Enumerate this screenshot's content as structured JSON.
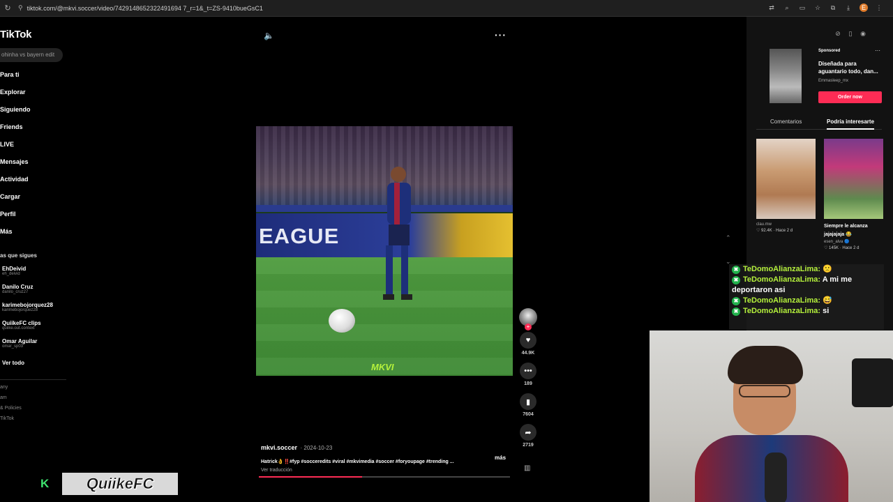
{
  "browser": {
    "url": "tiktok.com/@mkvi.soccer/video/7429148652322491694 7_r=1&_t=ZS-9410bueGsC1"
  },
  "sidebar": {
    "logo": "TikTok",
    "search_placeholder": "ohinha vs bayern edit",
    "nav": [
      "Para ti",
      "Explorar",
      "Siguiendo",
      "Friends",
      "LIVE",
      "Mensajes",
      "Actividad",
      "Cargar",
      "Perfil",
      "Más"
    ],
    "following_title": "as que sigues",
    "following": [
      {
        "name": "EhDeivid",
        "handle": "eh_deivid"
      },
      {
        "name": "Danilo Cruz",
        "handle": "danilo_cruz27"
      },
      {
        "name": "karimebojorquez28",
        "handle": "karimebojorquez28"
      },
      {
        "name": "QuiikeFC clips",
        "handle": "quiike.out.context"
      },
      {
        "name": "Omar Aguilar",
        "handle": "omar_sp03"
      }
    ],
    "see_all": "Ver todo",
    "footer": [
      "any",
      "am",
      "& Policies",
      "TikTok"
    ]
  },
  "video": {
    "banner_text": "EAGUE",
    "watermark": "MKVI",
    "author": "mkvi.soccer",
    "date": "· 2024-10-23",
    "description": "Hatrick👌‼️#fyp #socceredits #viral #mkvimedia #soccer #foryoupage #trending ...",
    "more": "más",
    "translate": "Ver traducción",
    "progress": 0.41
  },
  "actions": {
    "likes": "44.9K",
    "comments": "189",
    "saves": "7604",
    "shares": "2719"
  },
  "right": {
    "ad": {
      "sponsored": "Sponsored",
      "title": "Diseñada para aguantario todo, dan...",
      "handle": "Emmasleep_mx",
      "cta": "Order now"
    },
    "tabs": [
      "Comentarios",
      "Podría interesarte"
    ],
    "cards": [
      {
        "title": "",
        "user": "clau.mw",
        "meta": "♡ 92.4K · Hace 2 d"
      },
      {
        "title": "Siempre le alcanza jajajajaja 😂",
        "user": "esen_alva 🔵",
        "meta": "♡ 145K · Hace 2 d"
      }
    ]
  },
  "chat": [
    {
      "user": "TeDomoAlianzaLima:",
      "msg": "🙁"
    },
    {
      "user": "TeDomoAlianzaLima:",
      "msg": "A mi me deportaron asi"
    },
    {
      "user": "TeDomoAlianzaLima:",
      "msg": "😅"
    },
    {
      "user": "TeDomoAlianzaLima:",
      "msg": "si"
    }
  ],
  "stream_brand": {
    "logo_letter": "K",
    "name": "QuiikeFC"
  },
  "colors": {
    "accent": "#fe2c55",
    "chat_user": "#b6f23c",
    "brand_green": "#3ee36e"
  }
}
